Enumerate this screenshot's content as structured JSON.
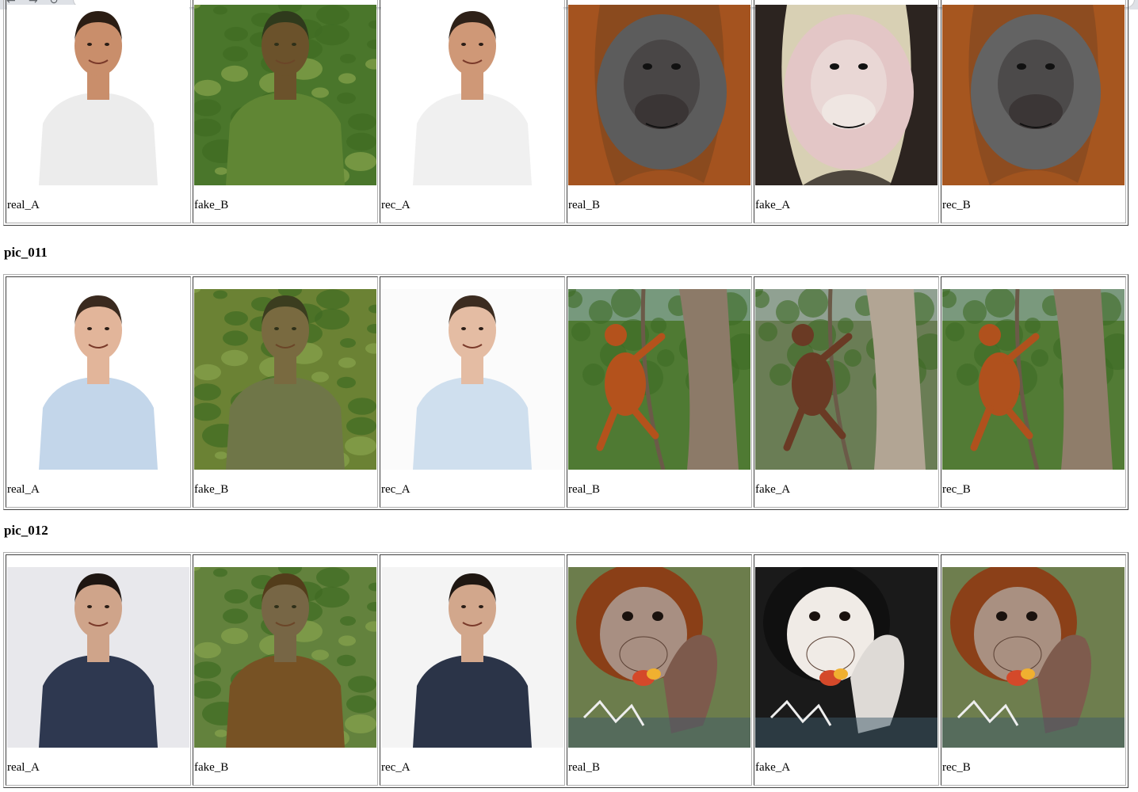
{
  "browser": {
    "nav_icons": [
      "back-icon",
      "forward-icon",
      "reload-icon"
    ]
  },
  "rows": [
    {
      "title": "",
      "cells": [
        {
          "label": "real_A",
          "kind": "person-real",
          "palette": {
            "bg": "#ffffff",
            "shirt": "#ececec",
            "skin": "#c98e6b",
            "hair": "#2b1d14"
          }
        },
        {
          "label": "fake_B",
          "kind": "person-fake",
          "palette": {
            "bg": "#4e7a2e",
            "shirt": "#6b8f3a",
            "skin": "#7a4a2e",
            "hair": "#2a2a1a"
          }
        },
        {
          "label": "rec_A",
          "kind": "person-real",
          "palette": {
            "bg": "#ffffff",
            "shirt": "#f0f0f0",
            "skin": "#cf9877",
            "hair": "#2e2118"
          }
        },
        {
          "label": "real_B",
          "kind": "orangutan-face",
          "palette": {
            "bg": "#8a4a1e",
            "face": "#5c5c5c",
            "muzzle": "#3a3535",
            "fur": "#a4531f"
          }
        },
        {
          "label": "fake_A",
          "kind": "orangutan-face",
          "palette": {
            "bg": "#d8d0b4",
            "face": "#e3c6c6",
            "muzzle": "#efe6e2",
            "fur": "#2c2420"
          }
        },
        {
          "label": "rec_B",
          "kind": "orangutan-face",
          "palette": {
            "bg": "#8d4c20",
            "face": "#636363",
            "muzzle": "#3b3636",
            "fur": "#a6561f"
          }
        }
      ]
    },
    {
      "title": "pic_011",
      "cells": [
        {
          "label": "real_A",
          "kind": "person-real",
          "palette": {
            "bg": "#ffffff",
            "shirt": "#c3d6ea",
            "skin": "#e2b59a",
            "hair": "#3a2a1f"
          }
        },
        {
          "label": "fake_B",
          "kind": "person-fake",
          "palette": {
            "bg": "#7a8a3a",
            "shirt": "#7f7a55",
            "skin": "#8c6a4a",
            "hair": "#3a2e1e"
          }
        },
        {
          "label": "rec_A",
          "kind": "person-real",
          "palette": {
            "bg": "#fbfbfb",
            "shirt": "#cfdfee",
            "skin": "#e4bca3",
            "hair": "#3c2c20"
          }
        },
        {
          "label": "real_B",
          "kind": "orangutan-tree",
          "palette": {
            "bg": "#4f7a33",
            "trunk": "#8c7a68",
            "ape": "#b4521c",
            "sky": "#9fb7c8"
          }
        },
        {
          "label": "fake_A",
          "kind": "orangutan-tree",
          "palette": {
            "bg": "#6a7d55",
            "trunk": "#b2a594",
            "ape": "#6a3a24",
            "sky": "#b5c6d0"
          }
        },
        {
          "label": "rec_B",
          "kind": "orangutan-tree",
          "palette": {
            "bg": "#527b35",
            "trunk": "#8f7d6a",
            "ape": "#b0511d",
            "sky": "#a2b8c6"
          }
        }
      ]
    },
    {
      "title": "pic_012",
      "cells": [
        {
          "label": "real_A",
          "kind": "person-real",
          "palette": {
            "bg": "#e8e8ec",
            "shirt": "#2e3850",
            "skin": "#cfa48a",
            "hair": "#1e1612"
          }
        },
        {
          "label": "fake_B",
          "kind": "person-fake",
          "palette": {
            "bg": "#6f8a46",
            "shirt": "#8a4a24",
            "skin": "#8a6450",
            "hair": "#5a2e18"
          }
        },
        {
          "label": "rec_A",
          "kind": "person-real",
          "palette": {
            "bg": "#f4f4f4",
            "shirt": "#2b3448",
            "skin": "#d2a78c",
            "hair": "#1f1712"
          }
        },
        {
          "label": "real_B",
          "kind": "orangutan-baby",
          "palette": {
            "bg": "#6c7d4c",
            "face": "#a88f82",
            "fur": "#8a3f17",
            "hand": "#7d5a4c"
          }
        },
        {
          "label": "fake_A",
          "kind": "orangutan-baby",
          "palette": {
            "bg": "#1a1a1a",
            "face": "#f0ebe6",
            "fur": "#101010",
            "hand": "#dedad6"
          }
        },
        {
          "label": "rec_B",
          "kind": "orangutan-baby",
          "palette": {
            "bg": "#6e7e4e",
            "face": "#a99081",
            "fur": "#8b4018",
            "hand": "#7e5b4d"
          }
        }
      ]
    }
  ]
}
